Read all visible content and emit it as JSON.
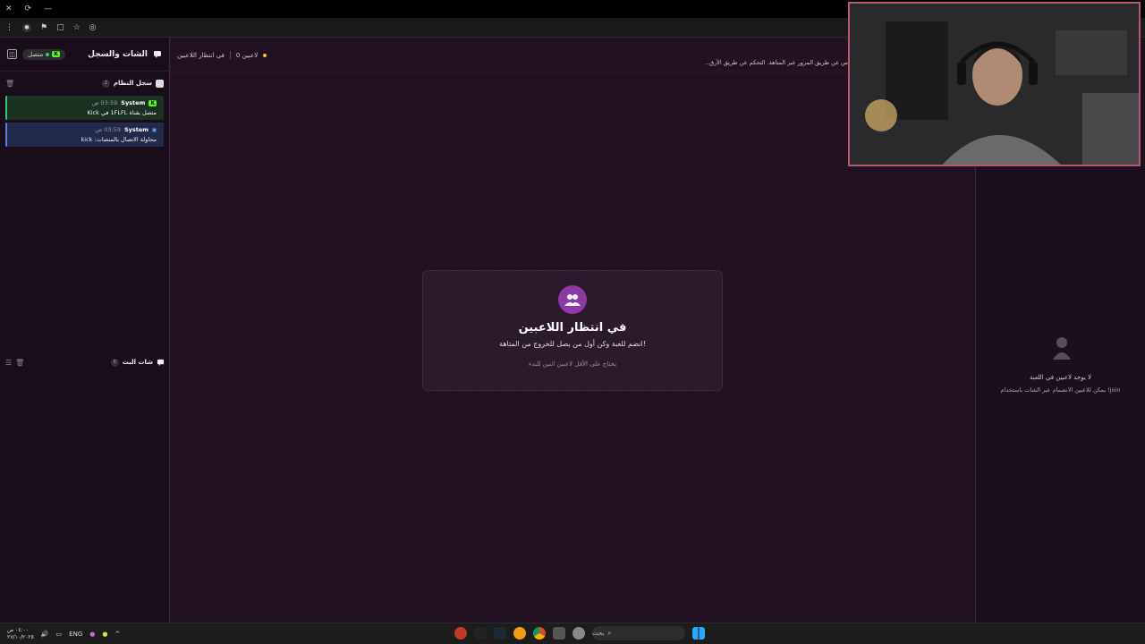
{
  "browser": {
    "close": "✕",
    "reload": "⟳",
    "back": "←",
    "url_fragment": "ⓞ"
  },
  "sidebar": {
    "title": "الشات والسجل",
    "status": "متصل",
    "system_log": {
      "label": "سجل النظام",
      "count": "2",
      "entries": [
        {
          "sender": "System",
          "time": "03:59 ص",
          "message": "متصل بقناة 1FLFL في Kick"
        },
        {
          "sender": "System",
          "time": "03:59 ص",
          "message": "محاولة الاتصال بالمنصات: kick"
        }
      ]
    },
    "stream_chat": {
      "label": "شات البث",
      "count": "0"
    }
  },
  "main": {
    "players_count": "0 لاعبين",
    "status": "في انتظار اللاعبين",
    "marquee": "س عن طريق المرور عبر المتاهة. التحكم عن طريق الأرق..."
  },
  "card": {
    "title": "في انتظار اللاعبين",
    "subtitle": "انضم للعبة وكن أول من يصل للخروج من المتاهة!",
    "hint": "يحتاج على الأقل لاعبين اثنين للبدء"
  },
  "right_panel": {
    "empty_title": "لا يوجد لاعبين في اللعبة",
    "empty_desc": "يمكن للاعبين الانضمام عبر الشات باستخدام !join"
  },
  "taskbar": {
    "clock_time": "٠٤:٠٠ ص",
    "clock_date": "٢٧/١٠/٢٠٢٥",
    "lang": "ENG",
    "search_placeholder": "بحث"
  },
  "colors": {
    "accent": "#8e3aa6",
    "kick_green": "#53fc18",
    "online_green": "#2ecc71"
  }
}
